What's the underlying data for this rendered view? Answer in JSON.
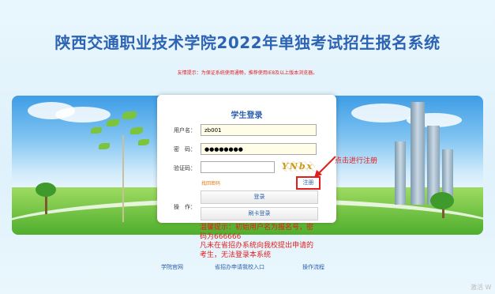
{
  "header": {
    "title": "陕西交通职业技术学院2022年单独考试招生报名系统",
    "tip": "友情提示：为保证系统使用通畅，推荐使用IE8及以上版本浏览器。"
  },
  "login": {
    "title": "学生登录",
    "username_label": "用户名：",
    "username_value": "zb001",
    "password_label": "密　码：",
    "password_value": "●●●●●●●●",
    "captcha_label": "验证码：",
    "captcha_value": "",
    "captcha_image_text": "YNbx",
    "forgot_label": "找回密码",
    "register_label": "注册",
    "operation_label": "操　作：",
    "login_button": "登录",
    "card_login_button": "刷卡登录"
  },
  "annotations": {
    "register_hint": "点击进行注册",
    "note": "温馨提示：初始用户名为报名号，密码为666666\n凡未在省招办系统向我校提出申请的考生，无法登录本系统"
  },
  "footer": {
    "links": [
      "学院官网",
      "省招办申请我校入口",
      "操作流程"
    ]
  },
  "watermark": "激活 W",
  "colors": {
    "title": "#2c63b3",
    "alert": "#e21d1d",
    "accent": "#2a5fad"
  }
}
